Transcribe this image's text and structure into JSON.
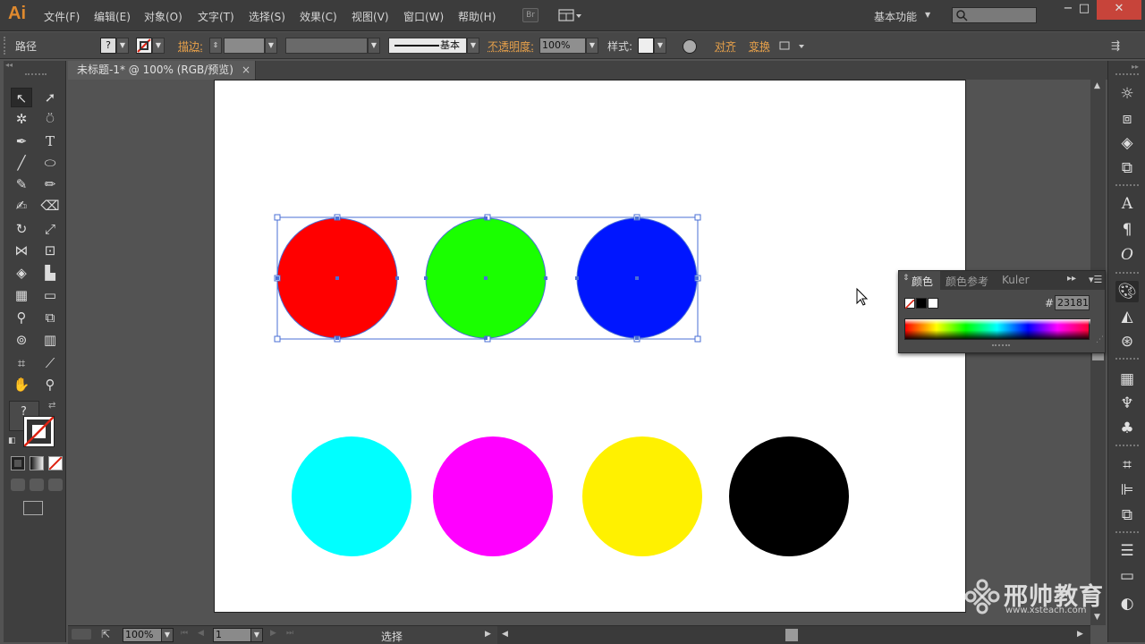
{
  "app": {
    "logo": "Ai"
  },
  "menu": [
    "文件(F)",
    "编辑(E)",
    "对象(O)",
    "文字(T)",
    "选择(S)",
    "效果(C)",
    "视图(V)",
    "窗口(W)",
    "帮助(H)"
  ],
  "menu_bridge": "Br",
  "workspace": "基本功能",
  "window_controls": {
    "minimize": "−",
    "restore": "□",
    "close": "✕"
  },
  "control_bar": {
    "object_type": "路径",
    "fill_placeholder": "?",
    "stroke_label": "描边:",
    "stroke_style": "基本",
    "opacity_label": "不透明度:",
    "opacity_value": "100%",
    "style_label": "样式:",
    "align_label": "对齐",
    "transform_label": "变换"
  },
  "document_tab": {
    "title": "未标题-1* @ 100% (RGB/预览)",
    "close": "×"
  },
  "color_panel": {
    "tabs": [
      "颜色",
      "颜色参考",
      "Kuler"
    ],
    "hex_label": "#",
    "hex_value": "231815",
    "colors": {
      "black": "#000000",
      "white": "#ffffff"
    }
  },
  "status_bar": {
    "zoom": "100%",
    "artboard_number": "1",
    "tool_status": "选择"
  },
  "watermark": {
    "brand": "邢帅教育",
    "url": "www.xsteach.com"
  },
  "canvas": {
    "selected_circles": [
      {
        "name": "red-circle",
        "color": "#ff0000"
      },
      {
        "name": "green-circle",
        "color": "#1aff00"
      },
      {
        "name": "blue-circle",
        "color": "#0016ff"
      }
    ],
    "cmyk_circles": [
      {
        "name": "cyan-circle",
        "color": "#00ffff"
      },
      {
        "name": "magenta-circle",
        "color": "#ff00ff"
      },
      {
        "name": "yellow-circle",
        "color": "#fff100"
      },
      {
        "name": "black-circle",
        "color": "#000000"
      }
    ],
    "selection_color": "#4a6fd6"
  },
  "accent_color": "#e6a04a"
}
